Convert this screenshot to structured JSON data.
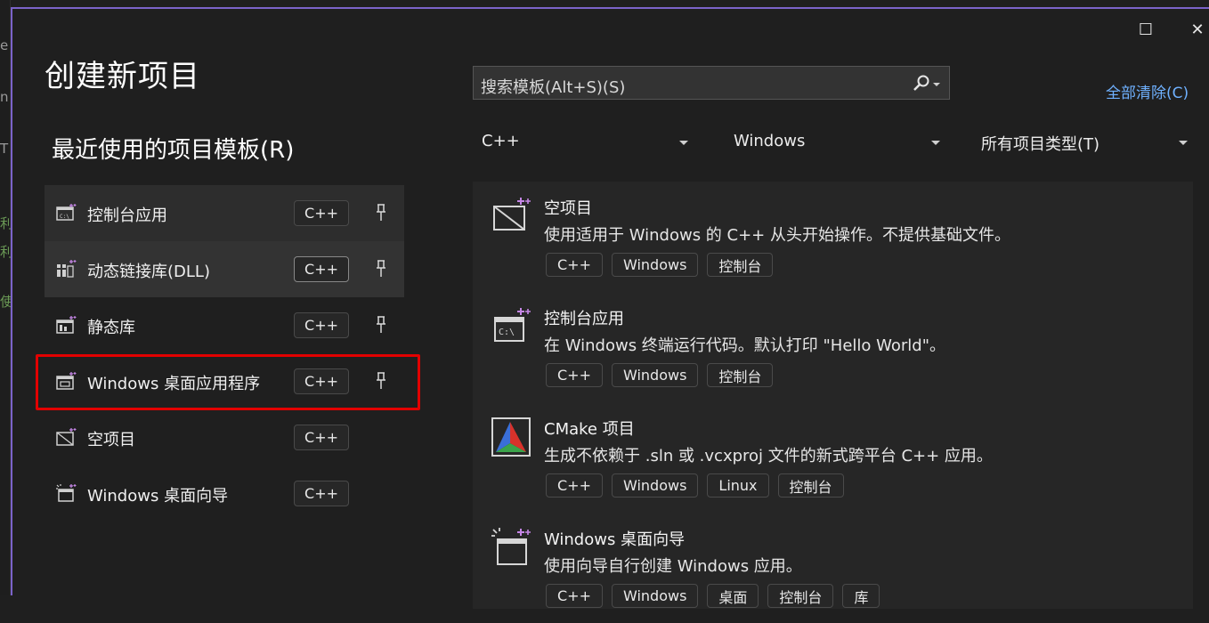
{
  "window": {
    "title": "创建新项目",
    "maximize_glyph": "☐",
    "close_glyph": "✕"
  },
  "background_glyphs": [
    "e",
    "n",
    "T",
    "利",
    "利",
    "使"
  ],
  "recent": {
    "title": "最近使用的项目模板(R)",
    "items": [
      {
        "label": "控制台应用",
        "tag": "C++",
        "icon": "console-app-icon",
        "pinned": true
      },
      {
        "label": "动态链接库(DLL)",
        "tag": "C++",
        "icon": "dll-icon",
        "pinned": true
      },
      {
        "label": "静态库",
        "tag": "C++",
        "icon": "static-lib-icon",
        "pinned": true
      },
      {
        "label": "Windows 桌面应用程序",
        "tag": "C++",
        "icon": "desktop-app-icon",
        "pinned": true
      },
      {
        "label": "空项目",
        "tag": "C++",
        "icon": "empty-project-icon",
        "pinned": false
      },
      {
        "label": "Windows 桌面向导",
        "tag": "C++",
        "icon": "desktop-wizard-icon",
        "pinned": false
      }
    ]
  },
  "search": {
    "placeholder": "搜索模板(Alt+S)(S)"
  },
  "clear_all": "全部清除(C)",
  "filters": {
    "language": "C++",
    "platform": "Windows",
    "project_type": "所有项目类型(T)"
  },
  "templates": [
    {
      "name": "空项目",
      "desc": "使用适用于 Windows 的 C++ 从头开始操作。不提供基础文件。",
      "tags": [
        "C++",
        "Windows",
        "控制台"
      ],
      "icon": "empty-project-icon"
    },
    {
      "name": "控制台应用",
      "desc": "在 Windows 终端运行代码。默认打印 \"Hello World\"。",
      "tags": [
        "C++",
        "Windows",
        "控制台"
      ],
      "icon": "console-app-icon"
    },
    {
      "name": "CMake 项目",
      "desc": "生成不依赖于 .sln 或 .vcxproj 文件的新式跨平台 C++ 应用。",
      "tags": [
        "C++",
        "Windows",
        "Linux",
        "控制台"
      ],
      "icon": "cmake-icon"
    },
    {
      "name": "Windows 桌面向导",
      "desc": "使用向导自行创建 Windows 应用。",
      "tags": [
        "C++",
        "Windows",
        "桌面",
        "控制台",
        "库"
      ],
      "icon": "desktop-wizard-icon"
    }
  ],
  "colors": {
    "accent_border": "#7b63c9",
    "highlight": "#e20000",
    "link": "#6fb1ff",
    "icon_sparkle": "#c586e6"
  }
}
